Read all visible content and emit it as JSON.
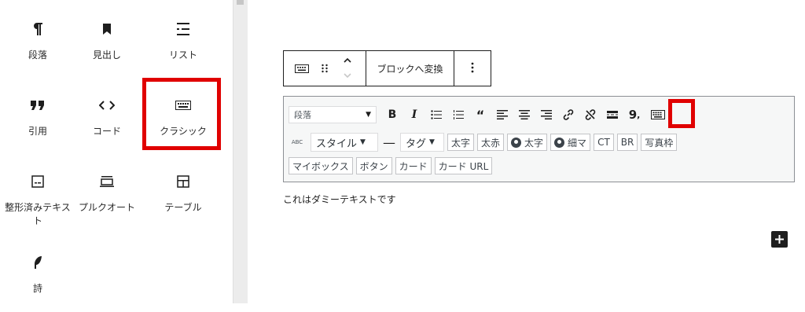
{
  "inserter": {
    "blocks": [
      {
        "label": "段落",
        "icon": "paragraph-icon"
      },
      {
        "label": "見出し",
        "icon": "heading-icon"
      },
      {
        "label": "リスト",
        "icon": "list-icon"
      },
      {
        "label": "引用",
        "icon": "quote-icon"
      },
      {
        "label": "コード",
        "icon": "code-icon"
      },
      {
        "label": "クラシック",
        "icon": "keyboard-icon"
      },
      {
        "label": "整形済みテキスト",
        "icon": "preformatted-icon"
      },
      {
        "label": "プルクオート",
        "icon": "pullquote-icon"
      },
      {
        "label": "テーブル",
        "icon": "table-icon"
      },
      {
        "label": "詩",
        "icon": "verse-icon"
      }
    ]
  },
  "block_toolbar": {
    "transform_label": "ブロックへ変換"
  },
  "classic_toolbar": {
    "format_value": "段落",
    "row2": {
      "abc": "ABC",
      "style_label": "スタイル",
      "tag_label": "タグ",
      "buttons": [
        "太字",
        "太赤",
        "太字",
        "細マ",
        "CT",
        "BR",
        "写真枠"
      ]
    },
    "row3": {
      "buttons": [
        "マイボックス",
        "ボタン",
        "カード",
        "カード URL"
      ]
    }
  },
  "content": {
    "dummy_text": "これはダミーテキストです"
  },
  "colors": {
    "highlight": "#e00000",
    "text": "#1e1e1e"
  }
}
